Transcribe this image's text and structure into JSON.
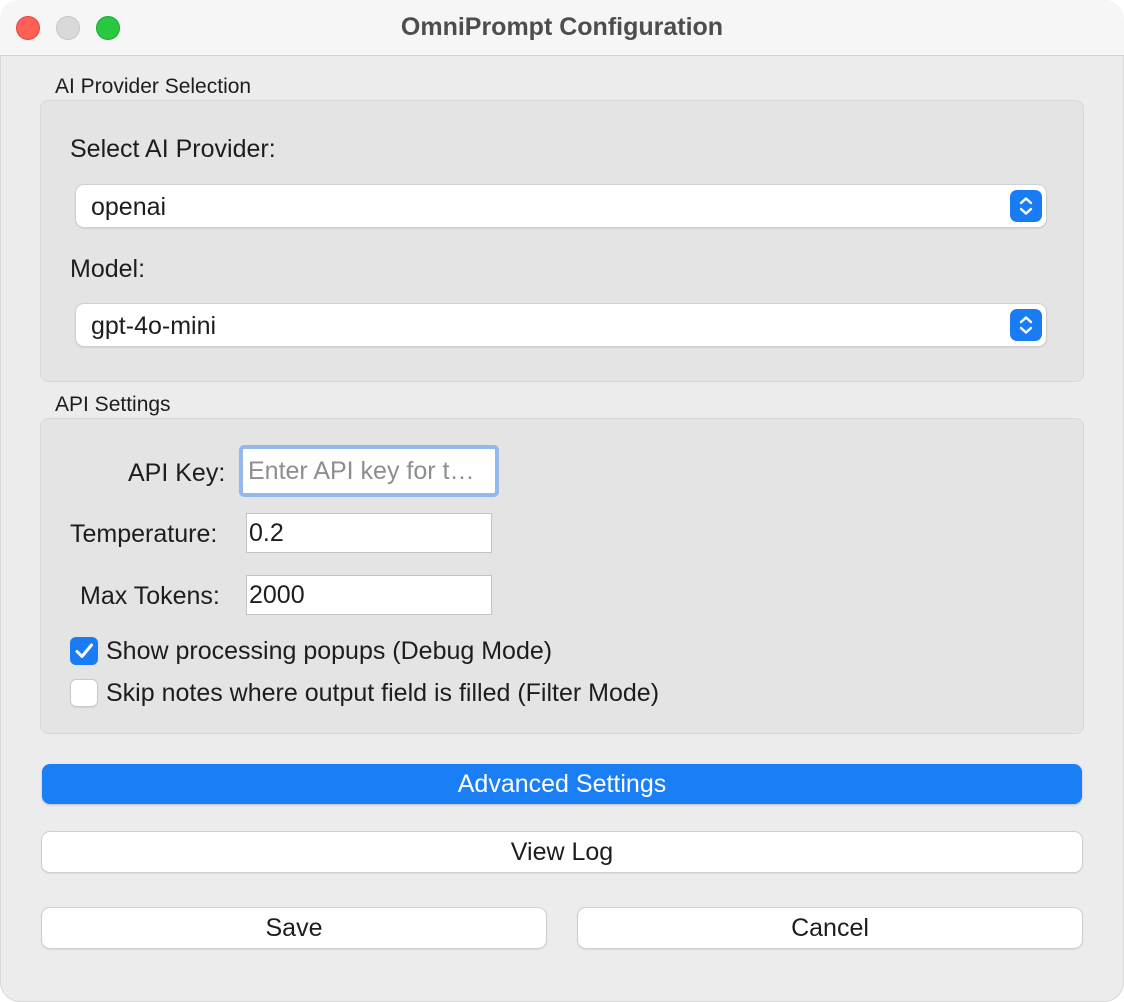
{
  "window": {
    "title": "OmniPrompt Configuration"
  },
  "provider_group": {
    "title": "AI Provider Selection",
    "provider_label": "Select AI Provider:",
    "provider_value": "openai",
    "model_label": "Model:",
    "model_value": "gpt-4o-mini"
  },
  "api_group": {
    "title": "API Settings",
    "api_key_label": "API Key:",
    "api_key_value": "",
    "api_key_placeholder": "Enter API key for t…",
    "temperature_label": "Temperature:",
    "temperature_value": "0.2",
    "max_tokens_label": "Max Tokens:",
    "max_tokens_value": "2000",
    "debug_checkbox_label": "Show processing popups (Debug Mode)",
    "debug_checked": true,
    "filter_checkbox_label": "Skip notes where output field is filled (Filter Mode)",
    "filter_checked": false
  },
  "buttons": {
    "advanced": "Advanced Settings",
    "view_log": "View Log",
    "save": "Save",
    "cancel": "Cancel"
  },
  "colors": {
    "accent": "#1a7ff6",
    "focus_ring": "#93b7ee",
    "close": "#ff5f57",
    "zoom": "#28c840"
  }
}
